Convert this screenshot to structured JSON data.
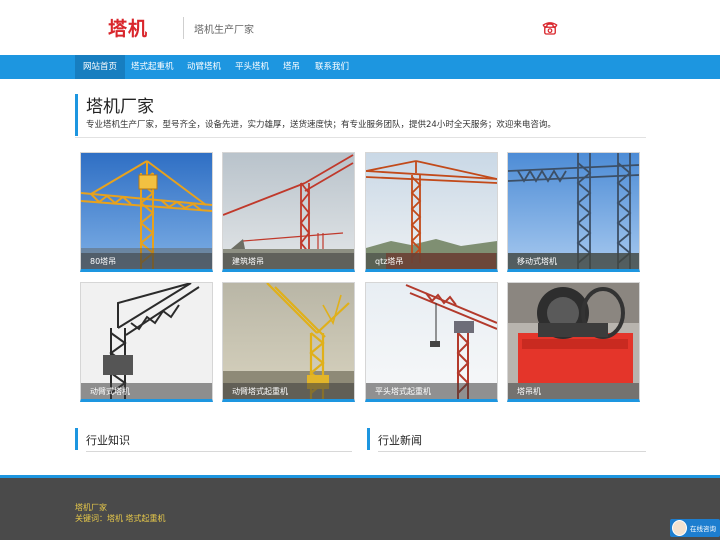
{
  "header": {
    "logo": "塔机",
    "tagline": "塔机生产厂家"
  },
  "nav": {
    "items": [
      {
        "label": "网站首页",
        "active": true
      },
      {
        "label": "塔式起重机",
        "active": false
      },
      {
        "label": "动臂塔机",
        "active": false
      },
      {
        "label": "平头塔机",
        "active": false
      },
      {
        "label": "塔吊",
        "active": false
      },
      {
        "label": "联系我们",
        "active": false
      }
    ]
  },
  "intro": {
    "title": "塔机厂家",
    "description": "专业塔机生产厂家，型号齐全，设备先进，实力雄厚，送货速度快；有专业服务团队，提供24小时全天服务；欢迎来电咨询。"
  },
  "products": [
    {
      "label": "80塔吊"
    },
    {
      "label": "建筑塔吊"
    },
    {
      "label": "qtz塔吊"
    },
    {
      "label": "移动式塔机"
    },
    {
      "label": "动臂式塔机"
    },
    {
      "label": "动臂塔式起重机"
    },
    {
      "label": "平头塔式起重机"
    },
    {
      "label": "塔吊机"
    }
  ],
  "sections": {
    "knowledge": "行业知识",
    "news": "行业新闻"
  },
  "footer": {
    "name": "塔机厂家",
    "keywords": "关键词：塔机 塔式起重机"
  },
  "chat": {
    "label": "在线咨询"
  },
  "colors": {
    "accent": "#1d96e0",
    "brand": "#d9262c",
    "footer_text": "#e6c84a"
  },
  "icons": {
    "phone": "phone-icon"
  }
}
